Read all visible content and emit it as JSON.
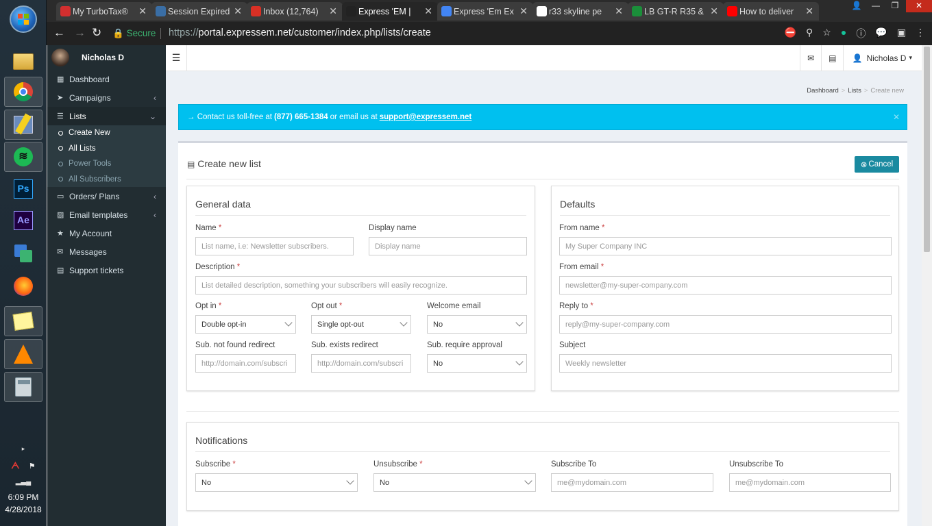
{
  "taskbar": {
    "icons": [
      "windows-start",
      "file-explorer",
      "chrome",
      "network-connector",
      "spotify",
      "photoshop",
      "after-effects",
      "file-transfer",
      "firefox",
      "sticky-notes",
      "vlc",
      "calculator"
    ],
    "ps_label": "Ps",
    "ae_label": "Ae",
    "time": "6:09 PM",
    "date": "4/28/2018"
  },
  "browser": {
    "tabs": [
      {
        "title": "My TurboTax®",
        "color": "#d32f2f"
      },
      {
        "title": "Session Expired",
        "color": "#3a6ea5"
      },
      {
        "title": "Inbox (12,764)",
        "color": "#d93025"
      },
      {
        "title": "Express 'EM | ",
        "color": "#222222"
      },
      {
        "title": "Express 'Em Ex",
        "color": "#4285f4"
      },
      {
        "title": "r33 skyline pe",
        "color": "#ffffff"
      },
      {
        "title": "LB GT-R R35 &",
        "color": "#1b8f3a"
      },
      {
        "title": "How to deliver",
        "color": "#ff0000"
      }
    ],
    "secure_label": "Secure",
    "url_scheme": "https://",
    "url_rest": "portal.expressem.net/customer/index.php/lists/create"
  },
  "sidebar": {
    "user_name": "Nicholas D",
    "items": [
      {
        "label": "Dashboard",
        "icon": "dashboard-icon"
      },
      {
        "label": "Campaigns",
        "icon": "send-icon"
      },
      {
        "label": "Lists",
        "icon": "list-icon"
      },
      {
        "label": "Orders/ Plans",
        "icon": "credit-card-icon"
      },
      {
        "label": "Email templates",
        "icon": "picture-icon"
      },
      {
        "label": "My Account",
        "icon": "star-icon"
      },
      {
        "label": "Messages",
        "icon": "envelope-icon"
      },
      {
        "label": "Support tickets",
        "icon": "ticket-icon"
      }
    ],
    "lists_sub": [
      "Create New",
      "All Lists",
      "Power Tools",
      "All Subscribers"
    ]
  },
  "topbar": {
    "user_menu": "Nicholas D"
  },
  "breadcrumb": {
    "dashboard": "Dashboard",
    "lists": "Lists",
    "current": "Create new"
  },
  "callout": {
    "prefix": "→ Contact us toll-free at",
    "phone": "(877) 665-1384",
    "middle": "or email us at",
    "email": "support@expressem.net"
  },
  "page": {
    "title": "Create new list",
    "cancel_label": "Cancel"
  },
  "general": {
    "title": "General data",
    "name_label": "Name",
    "name_placeholder": "List name, i.e: Newsletter subscribers.",
    "display_label": "Display name",
    "display_placeholder": "Display name",
    "desc_label": "Description",
    "desc_placeholder": "List detailed description, something your subscribers will easily recognize.",
    "optin_label": "Opt in",
    "optin_value": "Double opt-in",
    "optout_label": "Opt out",
    "optout_value": "Single opt-out",
    "welcome_label": "Welcome email",
    "welcome_value": "No",
    "notfound_label": "Sub. not found redirect",
    "notfound_placeholder": "http://domain.com/subscri",
    "exists_label": "Sub. exists redirect",
    "exists_placeholder": "http://domain.com/subscri",
    "approval_label": "Sub. require approval",
    "approval_value": "No"
  },
  "defaults": {
    "title": "Defaults",
    "from_name_label": "From name",
    "from_name_placeholder": "My Super Company INC",
    "from_email_label": "From email",
    "from_email_placeholder": "newsletter@my-super-company.com",
    "reply_label": "Reply to",
    "reply_placeholder": "reply@my-super-company.com",
    "subject_label": "Subject",
    "subject_placeholder": "Weekly newsletter"
  },
  "notifications": {
    "title": "Notifications",
    "subscribe_label": "Subscribe",
    "subscribe_value": "No",
    "unsubscribe_label": "Unsubscribe",
    "unsubscribe_value": "No",
    "subscribe_to_label": "Subscribe To",
    "subscribe_to_placeholder": "me@mydomain.com",
    "unsubscribe_to_label": "Unsubscribe To",
    "unsubscribe_to_placeholder": "me@mydomain.com"
  }
}
